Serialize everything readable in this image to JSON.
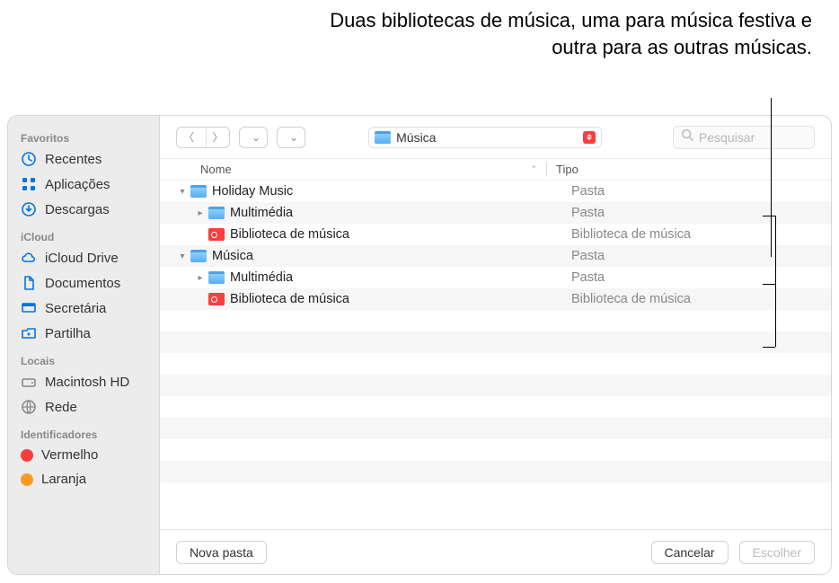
{
  "annotation": {
    "text": "Duas bibliotecas de música, uma para música festiva e outra para as outras músicas."
  },
  "sidebar": {
    "sections": [
      {
        "title": "Favoritos",
        "items": [
          {
            "icon": "clock",
            "label": "Recentes"
          },
          {
            "icon": "app-grid",
            "label": "Aplicações"
          },
          {
            "icon": "download",
            "label": "Descargas"
          }
        ]
      },
      {
        "title": "iCloud",
        "items": [
          {
            "icon": "cloud",
            "label": "iCloud Drive"
          },
          {
            "icon": "doc",
            "label": "Documentos"
          },
          {
            "icon": "desktop",
            "label": "Secretária"
          },
          {
            "icon": "share-folder",
            "label": "Partilha"
          }
        ]
      },
      {
        "title": "Locais",
        "items": [
          {
            "icon": "disk",
            "label": "Macintosh HD",
            "gray": true
          },
          {
            "icon": "globe",
            "label": "Rede",
            "gray": true
          }
        ]
      },
      {
        "title": "Identificadores",
        "items": [
          {
            "tag_color": "#fc3c3c",
            "label": "Vermelho"
          },
          {
            "tag_color": "#fd9a26",
            "label": "Laranja"
          }
        ]
      }
    ]
  },
  "toolbar": {
    "location_label": "Música",
    "search_placeholder": "Pesquisar"
  },
  "columns": {
    "name": "Nome",
    "type": "Tipo"
  },
  "rows": [
    {
      "indent": 0,
      "disclosure": "down",
      "icon": "folder",
      "name": "Holiday Music",
      "type": "Pasta"
    },
    {
      "indent": 1,
      "disclosure": "right",
      "icon": "folder",
      "name": "Multimédia",
      "type": "Pasta"
    },
    {
      "indent": 1,
      "disclosure": "",
      "icon": "music-file",
      "name": "Biblioteca de música",
      "type": "Biblioteca de música"
    },
    {
      "indent": 0,
      "disclosure": "down",
      "icon": "folder",
      "name": "Música",
      "type": "Pasta"
    },
    {
      "indent": 1,
      "disclosure": "right",
      "icon": "folder",
      "name": "Multimédia",
      "type": "Pasta"
    },
    {
      "indent": 1,
      "disclosure": "",
      "icon": "music-file",
      "name": "Biblioteca de música",
      "type": "Biblioteca de música"
    }
  ],
  "empty_rows": 8,
  "footer": {
    "new_folder": "Nova pasta",
    "cancel": "Cancelar",
    "choose": "Escolher"
  }
}
